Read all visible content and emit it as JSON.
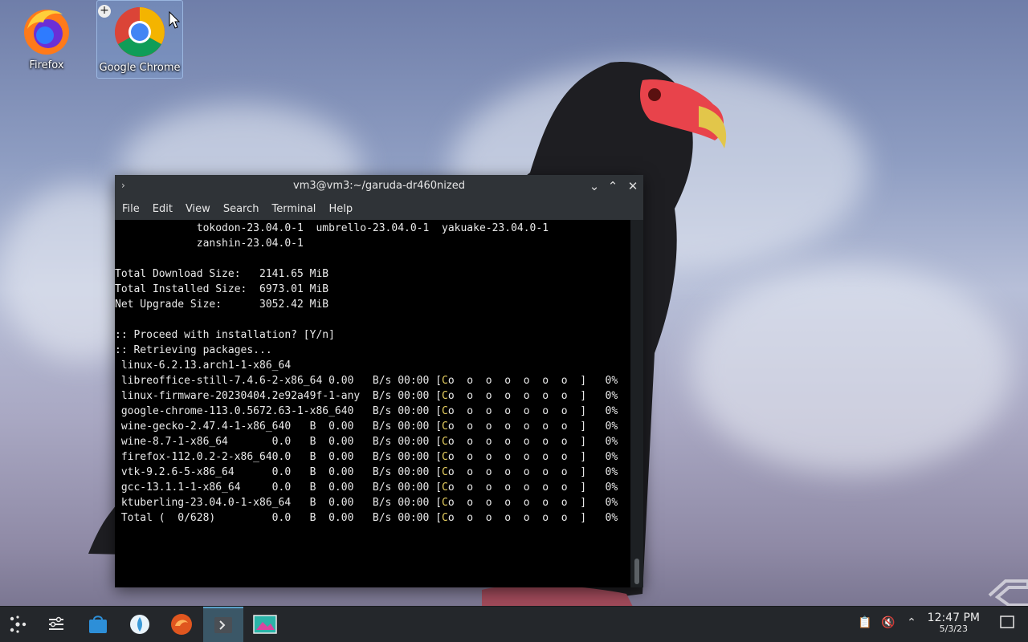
{
  "desktop": {
    "icons": [
      {
        "label": "Firefox"
      },
      {
        "label": "Google Chrome"
      }
    ]
  },
  "terminal": {
    "title": "vm3@vm3:~/garuda-dr460nized",
    "menu": [
      "File",
      "Edit",
      "View",
      "Search",
      "Terminal",
      "Help"
    ],
    "lines": [
      "             tokodon-23.04.0-1  umbrello-23.04.0-1  yakuake-23.04.0-1",
      "             zanshin-23.04.0-1",
      "",
      "Total Download Size:   2141.65 MiB",
      "Total Installed Size:  6973.01 MiB",
      "Net Upgrade Size:      3052.42 MiB",
      "",
      ":: Proceed with installation? [Y/n]",
      ":: Retrieving packages...",
      " linux-6.2.13.arch1-1-x86_64",
      " libreoffice-still-7.4.6-2-x86_64 0.00   B/s 00:00 [Co  o  o  o  o  o  o  ]   0%",
      " linux-firmware-20230404.2e92a49f-1-any  B/s 00:00 [Co  o  o  o  o  o  o  ]   0%",
      " google-chrome-113.0.5672.63-1-x86_640   B/s 00:00 [Co  o  o  o  o  o  o  ]   0%",
      " wine-gecko-2.47.4-1-x86_640   B  0.00   B/s 00:00 [Co  o  o  o  o  o  o  ]   0%",
      " wine-8.7-1-x86_64       0.0   B  0.00   B/s 00:00 [Co  o  o  o  o  o  o  ]   0%",
      " firefox-112.0.2-2-x86_640.0   B  0.00   B/s 00:00 [Co  o  o  o  o  o  o  ]   0%",
      " vtk-9.2.6-5-x86_64      0.0   B  0.00   B/s 00:00 [Co  o  o  o  o  o  o  ]   0%",
      " gcc-13.1.1-1-x86_64     0.0   B  0.00   B/s 00:00 [Co  o  o  o  o  o  o  ]   0%",
      " ktuberling-23.04.0-1-x86_64   B  0.00   B/s 00:00 [Co  o  o  o  o  o  o  ]   0%",
      " Total (  0/628)         0.0   B  0.00   B/s 00:00 [Co  o  o  o  o  o  o  ]   0%"
    ]
  },
  "taskbar": {
    "apps": [
      "app-launcher-icon",
      "settings-icon",
      "store-icon",
      "garuda-icon",
      "firedragon-icon",
      "terminal-icon",
      "screenshot-icon"
    ],
    "clock_time": "12:47 PM",
    "clock_date": "5/3/23"
  },
  "colors": {
    "taskbar": "#24272b",
    "titlebar": "#2f3337",
    "active_task": "#3b5767"
  }
}
